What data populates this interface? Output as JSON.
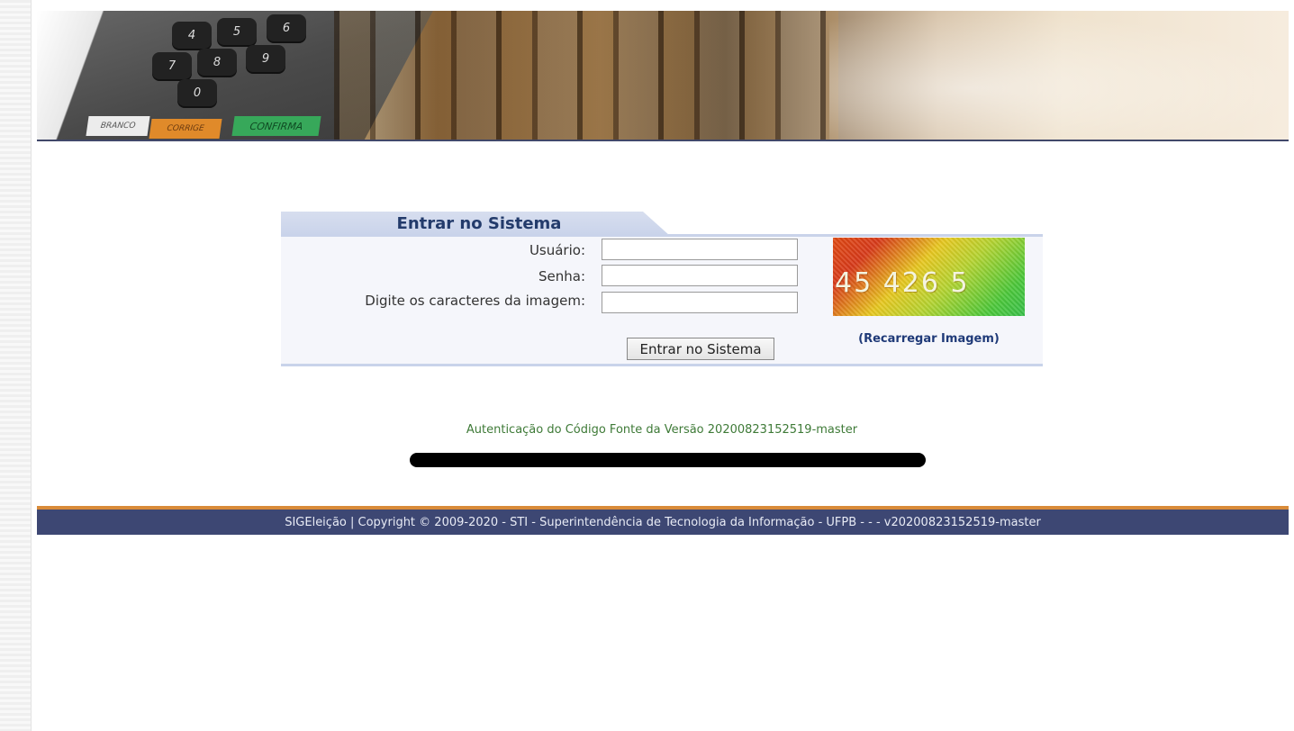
{
  "banner": {
    "keys": [
      "4",
      "5",
      "6",
      "7",
      "8",
      "9",
      "0"
    ],
    "key_labels": {
      "branco": "BRANCO",
      "corrige": "CORRIGE",
      "confirma": "CONFIRMA"
    }
  },
  "login": {
    "title": "Entrar no Sistema",
    "usuario_label": "Usuário:",
    "senha_label": "Senha:",
    "captcha_label": "Digite os caracteres da imagem:",
    "usuario_value": "",
    "senha_value": "",
    "captcha_value": "",
    "submit_label": "Entrar no Sistema",
    "captcha_text": "45 426 5",
    "reload_label": "(Recarregar Imagem)"
  },
  "version_text": "Autenticação do Código Fonte da Versão 20200823152519-master",
  "footer": {
    "text": "SIGEleição | Copyright © 2009-2020 - STI - Superintendência de Tecnologia da Informação - UFPB - - - v20200823152519-master"
  },
  "colors": {
    "tab_bg": "#c9d3ea",
    "title_color": "#233b6b",
    "link_color": "#1f3a78",
    "version_color": "#3e7a37",
    "footer_bg": "#3d4773",
    "footer_border": "#d98b39"
  }
}
